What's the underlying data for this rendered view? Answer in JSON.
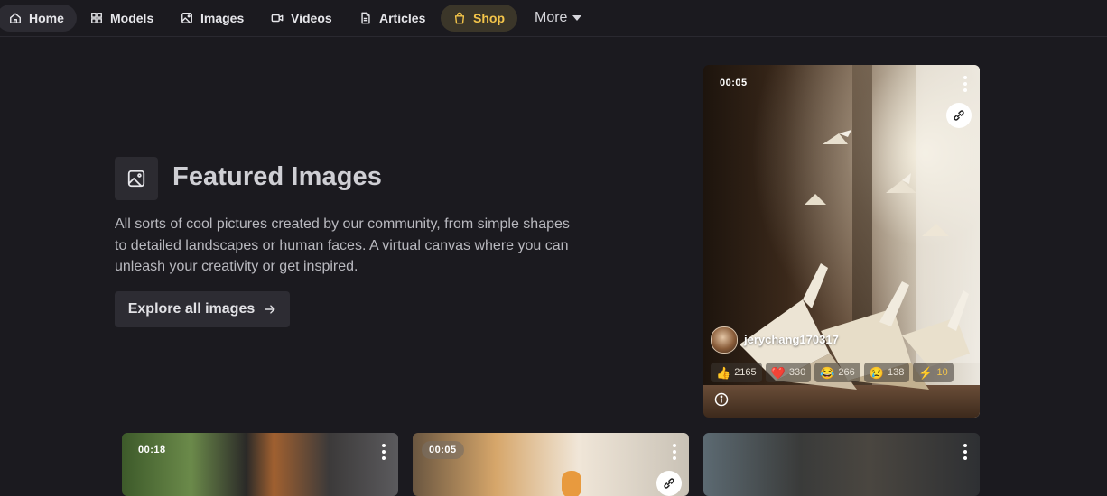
{
  "nav": {
    "home": "Home",
    "models": "Models",
    "images": "Images",
    "videos": "Videos",
    "articles": "Articles",
    "shop": "Shop",
    "more": "More"
  },
  "hero": {
    "title": "Featured Images",
    "description": "All sorts of cool pictures created by our community, from simple shapes to detailed landscapes or human faces. A virtual canvas where you can unleash your creativity or get inspired.",
    "cta": "Explore all images"
  },
  "featured_card": {
    "duration": "00:05",
    "username": "jerychang170317",
    "reactions": [
      {
        "icon": "thumbs-up-icon",
        "emoji": "👍",
        "count": "2165"
      },
      {
        "icon": "heart-icon",
        "emoji": "❤️",
        "count": "330"
      },
      {
        "icon": "laugh-icon",
        "emoji": "😂",
        "count": "266"
      },
      {
        "icon": "sad-icon",
        "emoji": "😢",
        "count": "138"
      },
      {
        "icon": "lightning-icon",
        "emoji": "⚡",
        "count": "10"
      }
    ]
  },
  "cards": [
    {
      "duration": "00:18"
    },
    {
      "duration": "00:05"
    },
    {
      "duration": ""
    }
  ],
  "colors": {
    "background": "#1b1a1f",
    "shop_accent": "#f4c54a",
    "button_bg": "#2d2c33"
  }
}
